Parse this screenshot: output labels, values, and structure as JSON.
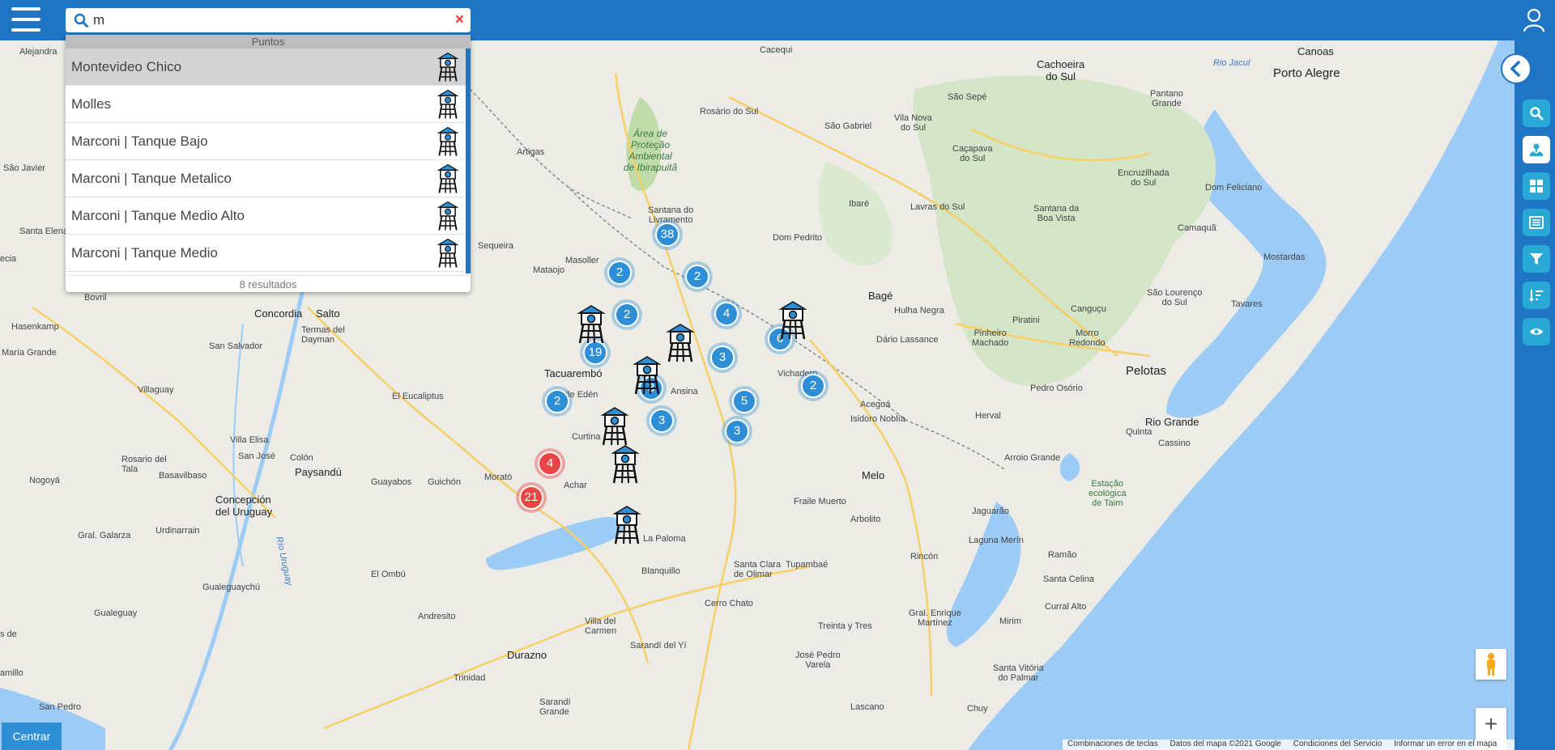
{
  "search": {
    "value": "m",
    "clear_icon": "×"
  },
  "dropdown": {
    "header": "Puntos",
    "results": [
      {
        "label": "Montevideo Chico",
        "icon": "water-tower-icon"
      },
      {
        "label": "Molles",
        "icon": "water-tower-icon"
      },
      {
        "label": "Marconi | Tanque Bajo",
        "icon": "water-tower-icon"
      },
      {
        "label": "Marconi | Tanque Metalico",
        "icon": "water-tower-icon"
      },
      {
        "label": "Marconi | Tanque Medio Alto",
        "icon": "water-tower-icon"
      },
      {
        "label": "Marconi | Tanque Medio",
        "icon": "water-tower-icon"
      }
    ],
    "count_text": "8 resultados"
  },
  "sidebar": {
    "items": [
      "search-icon",
      "map-icon",
      "grid-icon",
      "list-icon",
      "filter-icon",
      "sort-icon",
      "eye-icon"
    ],
    "active_index": 1
  },
  "clusters": [
    "38",
    "2",
    "2",
    "2",
    "4",
    "6",
    "19",
    "3",
    "3",
    "2",
    "5",
    "2",
    "3",
    "4",
    "21"
  ],
  "map_labels": {
    "alejandra": "Alejandra",
    "saojavier": "São Javier",
    "santalena": "Santa Elena",
    "recia": "ecia",
    "bovril": "Bovril",
    "hasenkamp": "Hasenkamp",
    "mariagrande": "María Grande",
    "concordia": "Concordia",
    "salto": "Salto",
    "termas": "Termas del\nDayman",
    "sansalvador": "San Salvador",
    "villaguay": "Villaguay",
    "eleucaliptus": "El Eucaliptus",
    "villaelisa": "Villa Elisa",
    "rosario": "Rosario del\nTala",
    "sanjose": "San José",
    "colon": "Colón",
    "paysandu": "Paysandú",
    "nogoya": "Nogoyá",
    "basavilbaso": "Basavilbaso",
    "concepcion": "Concepción\ndel Uruguay",
    "guayabos": "Guayabos",
    "guichon": "Guichón",
    "morato": "Morató",
    "galarza": "Gral. Galarza",
    "urdinarrain": "Urdinarrain",
    "elombu": "El Ombú",
    "gualeguaychu": "Gualeguaychú",
    "gualeguay": "Gualeguay",
    "andresito": "Andresito",
    "desde": "s de",
    "camillo": "amillo",
    "sanpedro": "San Pedro",
    "durazno": "Durazno",
    "trinidad": "Trinidad",
    "sarandigrande": "Sarandí\nGrande",
    "villadelcarmen": "Villa del\nCarmen",
    "sarandiyi": "Sarandí del Yí",
    "blanquillo": "Blanquillo",
    "lapaloma": "La Paloma",
    "achar": "Achar",
    "curtina": "Curtina",
    "valleeden": "Valle Edén",
    "tacuarembo": "Tacuarembó",
    "ansina": "Ansina",
    "sequeira": "Sequeira",
    "mataojo": "Mataojo",
    "masoller": "Masoller",
    "artigas": "Artigas",
    "santana": "Santana do\nLivramento",
    "area": "Área de\nProteção\nAmbiental\nde Ibirapuitã",
    "cacequi": "Cacequi",
    "rosariosul": "Rosário do Sul",
    "saogabriel": "São Gabriel",
    "domPedrito": "Dom Pedrito",
    "bage": "Bagé",
    "hulhanegra": "Hulha Negra",
    "acegua": "Aceguá",
    "isidoro": "Isidoro Noblía",
    "melo": "Melo",
    "fraile": "Fraile Muerto",
    "arbolito": "Arbolito",
    "vichadero": "Vichadero",
    "darioLassance": "Dário Lassance",
    "santaclara": "Santa Clara\nde Olimar",
    "tupambae": "Tupambaé",
    "cerrochato": "Cerro Chato",
    "treinta": "Treinta y Tres",
    "joseb": "José Pedro\nVarela",
    "lascano": "Lascano",
    "chuy": "Chuy",
    "santavitoria": "Santa Vitória\ndo Palmar",
    "mirim": "Mirim",
    "curralalto": "Curral Alto",
    "santacelina": "Santa Celina",
    "ramao": "Ramão",
    "rincon": "Rincón",
    "enrique": "Gral. Enrique\nMartínez",
    "laguna": "Laguna Merín",
    "jaguarao": "Jaguarão",
    "arroio": "Arroio Grande",
    "herval": "Herval",
    "estacao": "Estação\necológica\nde Taim",
    "riogrande": "Rio Grande",
    "cassino": "Cassino",
    "quinta": "Quinta",
    "pelotas": "Pelotas",
    "pedroosorio": "Pedro Osório",
    "morroredondo": "Morro\nRedondo",
    "pinheiro": "Pinheiro\nMachado",
    "pirati": "Piratini",
    "cangucu": "Canguçu",
    "saolourenco": "São Lourenço\ndo Sul",
    "tavares": "Tavares",
    "mostardas": "Mostardas",
    "camaqua": "Camaquã",
    "santanaboavista": "Santana da\nBoa Vista",
    "lavras": "Lavras do Sul",
    "ibare": "Ibaré",
    "cacapava": "Caçapava\ndo Sul",
    "vilanova": "Vila Nova\ndo Sul",
    "saosepe": "São Sepé",
    "cachoeira": "Cachoeira\ndo Sul",
    "pantano": "Pantano\nGrande",
    "encruzilhada": "Encruzilhada\ndo Sul",
    "domfeliciano": "Dom Feliciano",
    "portoalegre": "Porto Alegre",
    "canoas": "Canoas",
    "riojacui": "Rio Jacuí",
    "riouruguay": "Río Uruguay"
  },
  "attribution": [
    "Combinaciones de teclas",
    "Datos del mapa ©2021 Google",
    "Condiciones del Servicio",
    "Informar un error en el mapa"
  ],
  "controls": {
    "center": "Centrar",
    "zoom_in": "+",
    "zoom_out": "−"
  }
}
